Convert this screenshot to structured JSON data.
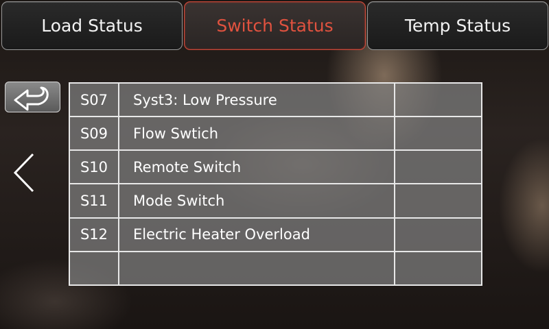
{
  "tabs": {
    "load_label": "Load Status",
    "switch_label": "Switch Status",
    "temp_label": "Temp Status",
    "active": "switch",
    "active_color": "#e0523f"
  },
  "nav": {
    "back_icon": "return-arrow-icon",
    "prev_icon": "chevron-left-icon"
  },
  "switches": [
    {
      "code": "S07",
      "name": "Syst3: Low Pressure",
      "value": ""
    },
    {
      "code": "S09",
      "name": "Flow Swtich",
      "value": ""
    },
    {
      "code": "S10",
      "name": "Remote Switch",
      "value": ""
    },
    {
      "code": "S11",
      "name": "Mode Switch",
      "value": ""
    },
    {
      "code": "S12",
      "name": "Electric Heater Overload",
      "value": ""
    },
    {
      "code": "",
      "name": "",
      "value": ""
    }
  ]
}
